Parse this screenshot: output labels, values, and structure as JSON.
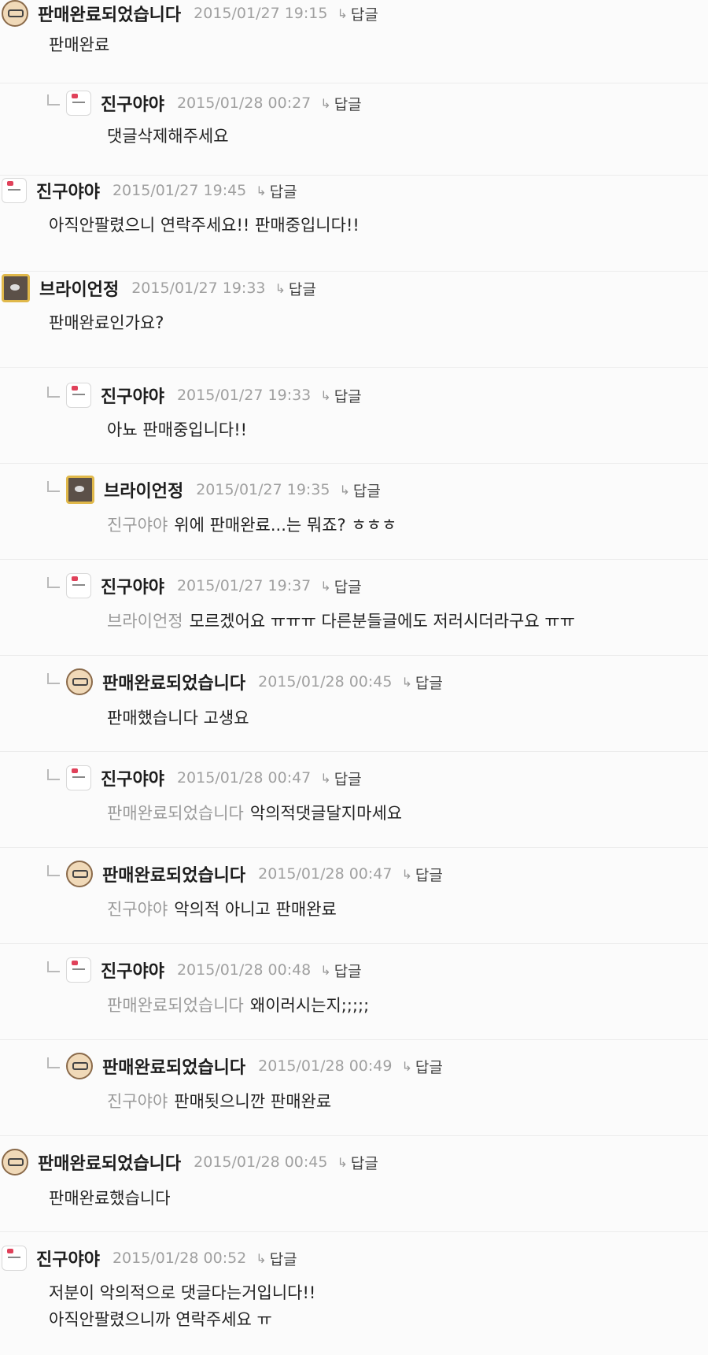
{
  "comments": [
    {
      "author": "판매완료되었습니다",
      "date": "2015/01/27 19:15",
      "reply": "답글",
      "avatar": "old-man-avatar",
      "mention": "",
      "text": [
        "판매완료"
      ]
    },
    {
      "author": "진구야야",
      "date": "2015/01/28 00:27",
      "reply": "답글",
      "avatar": "hello-kitty-avatar",
      "mention": "",
      "text": [
        "댓글삭제해주세요"
      ]
    },
    {
      "author": "진구야야",
      "date": "2015/01/27 19:45",
      "reply": "답글",
      "avatar": "hello-kitty-avatar",
      "mention": "",
      "text": [
        "아직안팔렸으니 연락주세요!! 판매중입니다!!"
      ]
    },
    {
      "author": "브라이언정",
      "date": "2015/01/27 19:33",
      "reply": "답글",
      "avatar": "brian-avatar",
      "mention": "",
      "text": [
        "판매완료인가요?"
      ]
    },
    {
      "author": "진구야야",
      "date": "2015/01/27 19:33",
      "reply": "답글",
      "avatar": "hello-kitty-avatar",
      "mention": "",
      "text": [
        "아뇨 판매중입니다!!"
      ]
    },
    {
      "author": "브라이언정",
      "date": "2015/01/27 19:35",
      "reply": "답글",
      "avatar": "brian-avatar",
      "mention": "진구야야",
      "text": [
        "위에 판매완료...는 뭐죠? ㅎㅎㅎ"
      ]
    },
    {
      "author": "진구야야",
      "date": "2015/01/27 19:37",
      "reply": "답글",
      "avatar": "hello-kitty-avatar",
      "mention": "브라이언정",
      "text": [
        "모르겠어요 ㅠㅠㅠ 다른분들글에도 저러시더라구요 ㅠㅠ"
      ]
    },
    {
      "author": "판매완료되었습니다",
      "date": "2015/01/28 00:45",
      "reply": "답글",
      "avatar": "old-man-avatar",
      "mention": "",
      "text": [
        "판매했습니다 고생요"
      ]
    },
    {
      "author": "진구야야",
      "date": "2015/01/28 00:47",
      "reply": "답글",
      "avatar": "hello-kitty-avatar",
      "mention": "판매완료되었습니다",
      "text": [
        "악의적댓글달지마세요"
      ]
    },
    {
      "author": "판매완료되었습니다",
      "date": "2015/01/28 00:47",
      "reply": "답글",
      "avatar": "old-man-avatar",
      "mention": "진구야야",
      "text": [
        "악의적 아니고 판매완료"
      ]
    },
    {
      "author": "진구야야",
      "date": "2015/01/28 00:48",
      "reply": "답글",
      "avatar": "hello-kitty-avatar",
      "mention": "판매완료되었습니다",
      "text": [
        "왜이러시는지;;;;;"
      ]
    },
    {
      "author": "판매완료되었습니다",
      "date": "2015/01/28 00:49",
      "reply": "답글",
      "avatar": "old-man-avatar",
      "mention": "진구야야",
      "text": [
        "판매됫으니깐 판매완료"
      ]
    },
    {
      "author": "판매완료되었습니다",
      "date": "2015/01/28 00:45",
      "reply": "답글",
      "avatar": "old-man-avatar",
      "mention": "",
      "text": [
        "판매완료했습니다"
      ]
    },
    {
      "author": "진구야야",
      "date": "2015/01/28 00:52",
      "reply": "답글",
      "avatar": "hello-kitty-avatar",
      "mention": "",
      "text": [
        "저분이 악의적으로 댓글다는거입니다!!",
        "아직안팔렸으니까 연락주세요 ㅠ"
      ]
    }
  ],
  "colors": {
    "background": "#fbfbfb",
    "author": "#1d1d1d",
    "date": "#a0a0a0",
    "mention": "#9a9a9a",
    "divider": "#ececec"
  }
}
